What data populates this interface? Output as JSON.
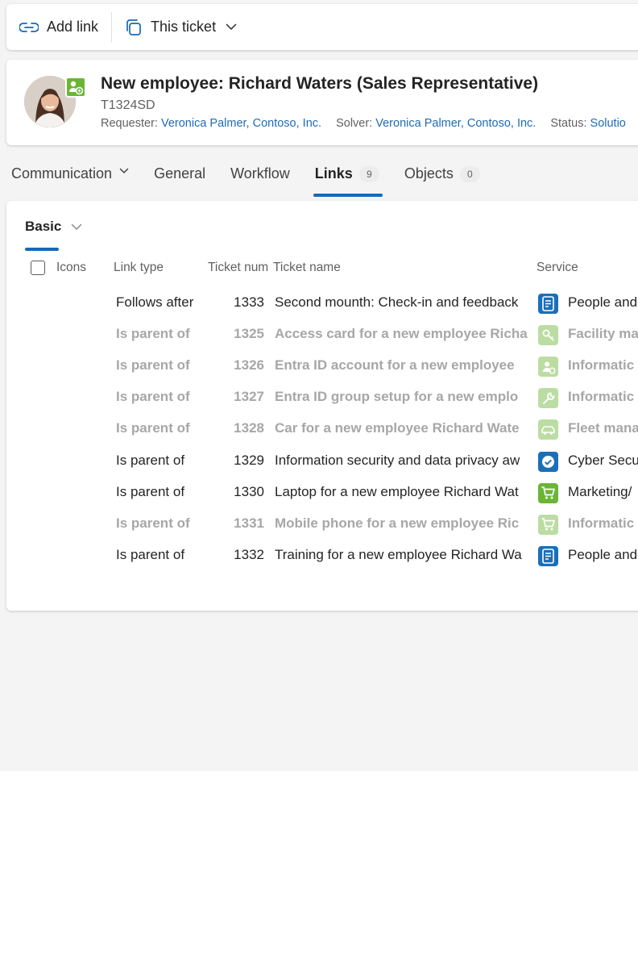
{
  "toolbar": {
    "add_link_label": "Add link",
    "scope_label": "This ticket"
  },
  "ticket": {
    "title": "New employee: Richard Waters (Sales Representative)",
    "id": "T1324SD",
    "requester_label": "Requester:",
    "requester": "Veronica Palmer, Contoso, Inc.",
    "solver_label": "Solver:",
    "solver": "Veronica Palmer, Contoso, Inc.",
    "status_label": "Status:",
    "status": "Solutio"
  },
  "tabs": [
    {
      "label": "Communication",
      "has_dropdown": true
    },
    {
      "label": "General"
    },
    {
      "label": "Workflow"
    },
    {
      "label": "Links",
      "count": "9",
      "active": true
    },
    {
      "label": "Objects",
      "count": "0"
    }
  ],
  "view": {
    "label": "Basic"
  },
  "table": {
    "headers": {
      "icons": "Icons",
      "link_type": "Link type",
      "ticket_num": "Ticket num",
      "ticket_name": "Ticket name",
      "service": "Service"
    },
    "rows": [
      {
        "link_type": "Follows after",
        "num": "1333",
        "name": "Second mounth: Check-in and feedback",
        "service": "People and",
        "icon": "document-icon",
        "dim": false
      },
      {
        "link_type": "Is parent of",
        "num": "1325",
        "name": "Access card for a new employee Richa",
        "service": "Facility ma",
        "icon": "key-icon",
        "dim": true
      },
      {
        "link_type": "Is parent of",
        "num": "1326",
        "name": "Entra ID account for a new employee",
        "service": "Informatic",
        "icon": "person-add-icon",
        "dim": true
      },
      {
        "link_type": "Is parent of",
        "num": "1327",
        "name": "Entra ID group setup for a new emplo",
        "service": "Informatic",
        "icon": "wrench-icon",
        "dim": true
      },
      {
        "link_type": "Is parent of",
        "num": "1328",
        "name": "Car for a new employee Richard Wate",
        "service": "Fleet mana",
        "icon": "car-icon",
        "dim": true
      },
      {
        "link_type": "Is parent of",
        "num": "1329",
        "name": "Information security and data privacy aw",
        "service": "Cyber Secu",
        "icon": "shield-check-icon",
        "dim": false
      },
      {
        "link_type": "Is parent of",
        "num": "1330",
        "name": "Laptop for a new employee Richard Wat",
        "service": "Marketing/",
        "icon": "cart-icon",
        "dim": false
      },
      {
        "link_type": "Is parent of",
        "num": "1331",
        "name": "Mobile phone for a new employee Ric",
        "service": "Informatic",
        "icon": "cart-icon",
        "dim": true
      },
      {
        "link_type": "Is parent of",
        "num": "1332",
        "name": "Training for a new employee Richard Wa",
        "service": "People and",
        "icon": "document-icon",
        "dim": false
      }
    ]
  },
  "colors": {
    "accent": "#1769b8",
    "link": "#1f6bb5",
    "green": "#6bb536",
    "blue_icon": "#1b6fb8"
  }
}
